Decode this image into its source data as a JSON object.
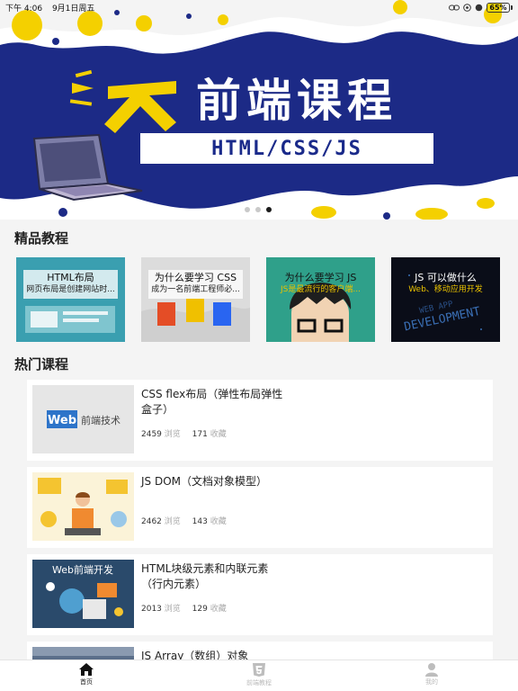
{
  "status_bar": {
    "time": "下午 4:06",
    "date": "9月1日周五",
    "battery_percent": 65,
    "battery_label": "65%"
  },
  "banner": {
    "title": "前端课程",
    "subtitle": "HTML/CSS/JS",
    "page_count": 3,
    "active_page": 2,
    "colors": {
      "background": "#1c2a86",
      "accent": "#f4d000"
    }
  },
  "featured": {
    "title": "精品教程",
    "items": [
      {
        "title": "HTML布局",
        "desc": "网页布局是创建网站时...",
        "bg": "#3a9fb0"
      },
      {
        "title": "为什么要学习 CSS",
        "desc": "成为一名前端工程师必...",
        "bg": "#dcdcdc"
      },
      {
        "title": "为什么要学习 JS",
        "desc": "JS是最流行的客户端...",
        "bg": "#2fa08a"
      },
      {
        "title": "JS 可以做什么",
        "desc": "Web、移动应用开发",
        "bg": "#0a0d18"
      }
    ]
  },
  "hot": {
    "title": "热门课程",
    "views_label": "浏览",
    "favs_label": "收藏",
    "items": [
      {
        "title": "CSS flex布局（弹性布局弹性盒子）",
        "views": "2459",
        "favs": "171",
        "thumb_text": "Web",
        "thumb_text2": "前端技术"
      },
      {
        "title": "JS DOM（文档对象模型）",
        "views": "2462",
        "favs": "143"
      },
      {
        "title": "HTML块级元素和内联元素（行内元素）",
        "views": "2013",
        "favs": "129",
        "thumb_text": "Web前端开发"
      },
      {
        "title": "JS Array（数组）对象",
        "views": "",
        "favs": ""
      }
    ]
  },
  "tabbar": {
    "items": [
      {
        "label": "首页",
        "icon": "home-icon",
        "active": true
      },
      {
        "label": "前端教程",
        "icon": "html5-icon",
        "active": false
      },
      {
        "label": "我的",
        "icon": "user-icon",
        "active": false
      }
    ]
  }
}
